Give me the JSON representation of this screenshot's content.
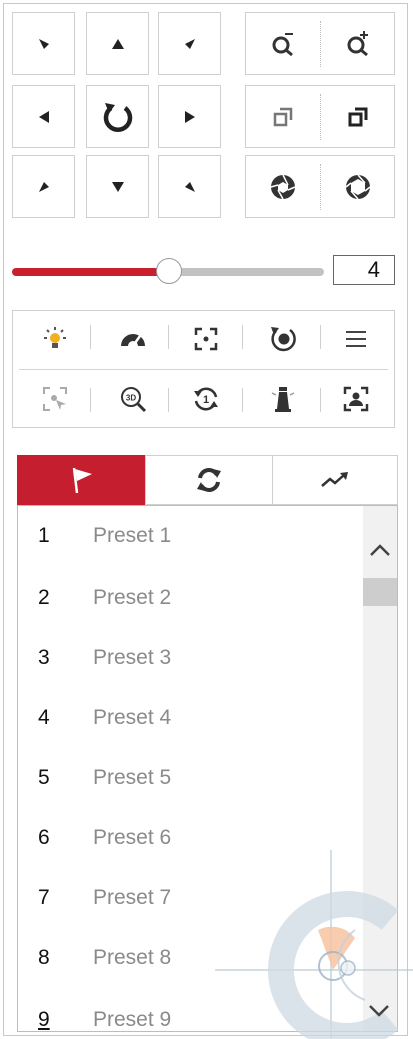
{
  "ptz": {
    "direction_buttons": [
      {
        "name": "pan-up-left-button",
        "icon": "arrow-up-left-icon"
      },
      {
        "name": "pan-up-button",
        "icon": "arrow-up-icon"
      },
      {
        "name": "pan-up-right-button",
        "icon": "arrow-up-right-icon"
      },
      {
        "name": "pan-left-button",
        "icon": "arrow-left-icon"
      },
      {
        "name": "auto-pan-button",
        "icon": "auto-rotate-icon"
      },
      {
        "name": "pan-right-button",
        "icon": "arrow-right-icon"
      },
      {
        "name": "pan-down-left-button",
        "icon": "arrow-down-left-icon"
      },
      {
        "name": "pan-down-button",
        "icon": "arrow-down-icon"
      },
      {
        "name": "pan-down-right-button",
        "icon": "arrow-down-right-icon"
      }
    ],
    "lens_controls": [
      {
        "name": "zoom-out-button",
        "icon": "zoom-out-icon"
      },
      {
        "name": "zoom-in-button",
        "icon": "zoom-in-icon"
      },
      {
        "name": "focus-near-button",
        "icon": "focus-near-icon"
      },
      {
        "name": "focus-far-button",
        "icon": "focus-far-icon"
      },
      {
        "name": "iris-close-button",
        "icon": "iris-close-icon"
      },
      {
        "name": "iris-open-button",
        "icon": "iris-open-icon"
      }
    ]
  },
  "speed": {
    "value": "4",
    "level_fraction": 0.43
  },
  "functions": {
    "row1": [
      "light-icon",
      "wiper-icon",
      "one-touch-focus-icon",
      "lens-initialization-icon",
      "menu-icon"
    ],
    "row2": [
      "manual-tracking-icon",
      "3d-zoom-icon",
      "park-action-icon",
      "auxiliary-focus-icon",
      "face-tracking-icon"
    ]
  },
  "tabs": [
    {
      "name": "tab-preset",
      "icon": "flag-icon",
      "active": true
    },
    {
      "name": "tab-patrol",
      "icon": "patrol-icon",
      "active": false
    },
    {
      "name": "tab-pattern",
      "icon": "pattern-icon",
      "active": false
    }
  ],
  "presets": [
    {
      "num": "1",
      "label": "Preset 1"
    },
    {
      "num": "2",
      "label": "Preset 2"
    },
    {
      "num": "3",
      "label": "Preset 3"
    },
    {
      "num": "4",
      "label": "Preset 4"
    },
    {
      "num": "5",
      "label": "Preset 5"
    },
    {
      "num": "6",
      "label": "Preset 6"
    },
    {
      "num": "7",
      "label": "Preset 7"
    },
    {
      "num": "8",
      "label": "Preset 8"
    },
    {
      "num": "9",
      "label": "Preset 9"
    }
  ],
  "colors": {
    "accent": "#c41e2f",
    "track": "#c2c2c2"
  }
}
